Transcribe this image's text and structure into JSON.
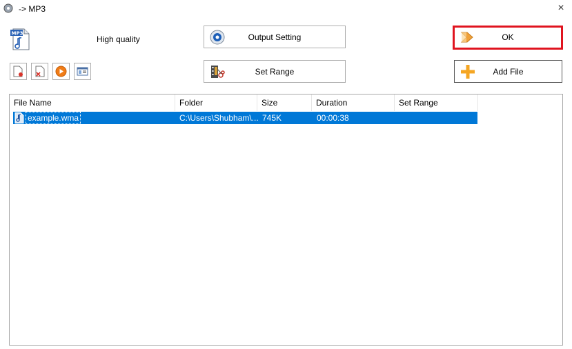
{
  "window": {
    "title": "-> MP3",
    "close": "×"
  },
  "quality": "High quality",
  "buttons": {
    "output_setting": "Output Setting",
    "set_range": "Set Range",
    "ok": "OK",
    "add_file": "Add File"
  },
  "toolbar_icons": [
    "new-file-icon",
    "remove-icon",
    "play-icon",
    "properties-icon"
  ],
  "table": {
    "columns": [
      "File Name",
      "Folder",
      "Size",
      "Duration",
      "Set Range"
    ],
    "rows": [
      {
        "file_name": "example.wma",
        "folder": "C:\\Users\\Shubham\\...",
        "size": "745K",
        "duration": "00:00:38",
        "set_range": ""
      }
    ]
  },
  "colors": {
    "selection": "#0078d7",
    "ok_highlight": "#e0141f",
    "add_plus": "#f5a623"
  }
}
